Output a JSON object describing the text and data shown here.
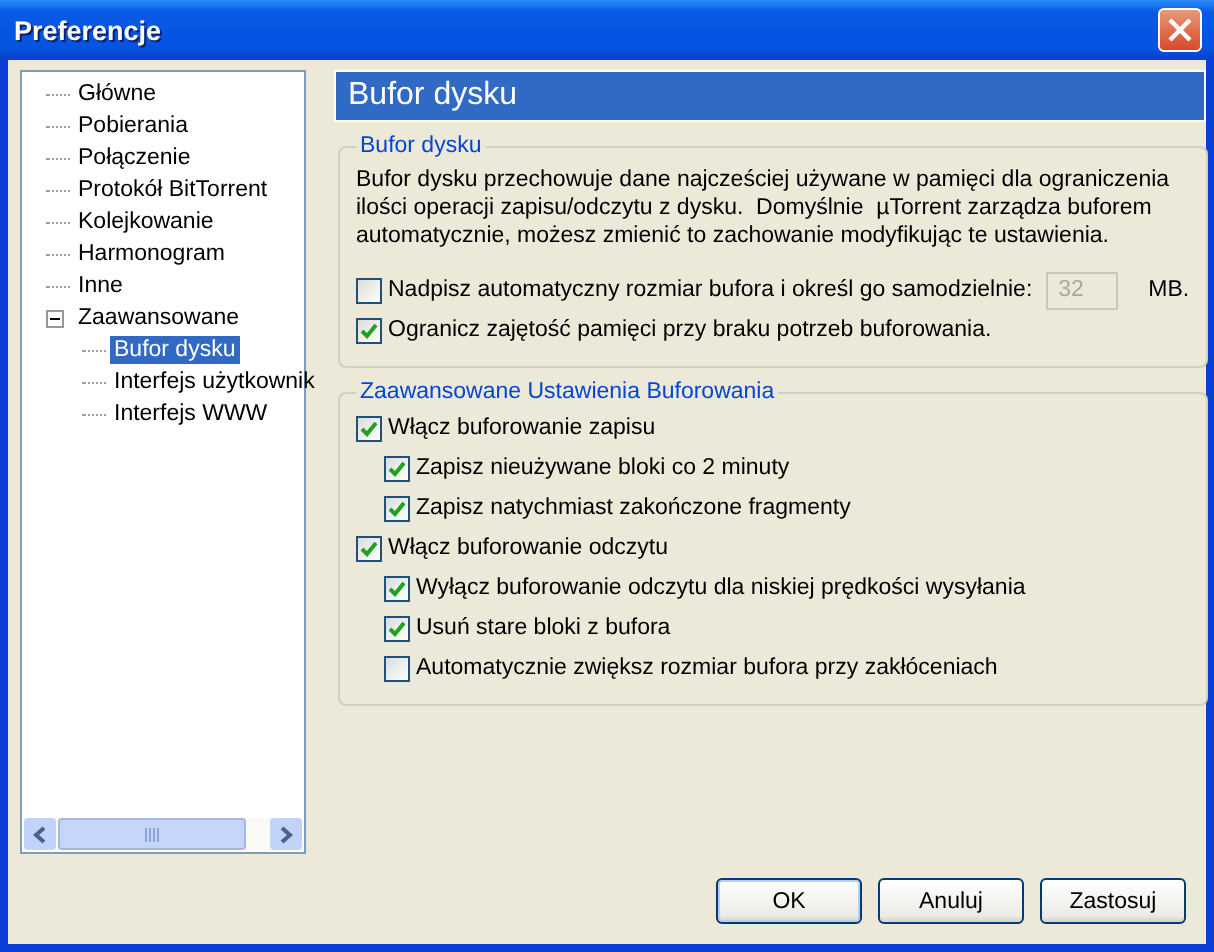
{
  "window": {
    "title": "Preferencje"
  },
  "sidebar": {
    "items": [
      {
        "label": "Główne",
        "selected": false
      },
      {
        "label": "Pobierania",
        "selected": false
      },
      {
        "label": "Połączenie",
        "selected": false
      },
      {
        "label": "Protokół BitTorrent",
        "selected": false
      },
      {
        "label": "Kolejkowanie",
        "selected": false
      },
      {
        "label": "Harmonogram",
        "selected": false
      },
      {
        "label": "Inne",
        "selected": false
      },
      {
        "label": "Zaawansowane",
        "selected": false,
        "expanded": true,
        "children": [
          {
            "label": "Bufor dysku",
            "selected": true
          },
          {
            "label": "Interfejs użytkownik",
            "selected": false
          },
          {
            "label": "Interfejs WWW",
            "selected": false
          }
        ]
      }
    ]
  },
  "panel": {
    "title": "Bufor dysku",
    "groups": [
      {
        "title": "Bufor dysku",
        "description": "Bufor dysku przechowuje dane najcześciej używane w pamięci dla ograniczenia ilości operacji zapisu/odczytu z dysku.  Domyślnie  µTorrent zarządza buforem automatycznie, możesz zmienić to zachowanie modyfikując te ustawienia.",
        "options": [
          {
            "kind": "checkbox-field",
            "label": "Nadpisz automatyczny rozmiar bufora i określ go samodzielnie:",
            "checked": false,
            "value": "32",
            "unit": "MB.",
            "disabled": true
          },
          {
            "kind": "checkbox",
            "label": "Ogranicz zajętość pamięci przy braku potrzeb buforowania.",
            "checked": true
          }
        ]
      },
      {
        "title": "Zaawansowane Ustawienia Buforowania",
        "options": [
          {
            "kind": "checkbox",
            "label": "Włącz buforowanie zapisu",
            "checked": true,
            "children": [
              {
                "kind": "checkbox",
                "label": "Zapisz nieużywane bloki co 2 minuty",
                "checked": true
              },
              {
                "kind": "checkbox",
                "label": "Zapisz natychmiast zakończone fragmenty",
                "checked": true
              }
            ]
          },
          {
            "kind": "checkbox",
            "label": "Włącz buforowanie odczytu",
            "checked": true,
            "children": [
              {
                "kind": "checkbox",
                "label": "Wyłącz buforowanie odczytu dla niskiej prędkości wysyłania",
                "checked": true
              },
              {
                "kind": "checkbox",
                "label": "Usuń stare bloki z bufora",
                "checked": true
              },
              {
                "kind": "checkbox",
                "label": "Automatycznie zwiększ rozmiar bufora przy zakłóceniach",
                "checked": false
              }
            ]
          }
        ]
      }
    ]
  },
  "buttons": [
    "OK",
    "Anuluj",
    "Zastosuj"
  ]
}
